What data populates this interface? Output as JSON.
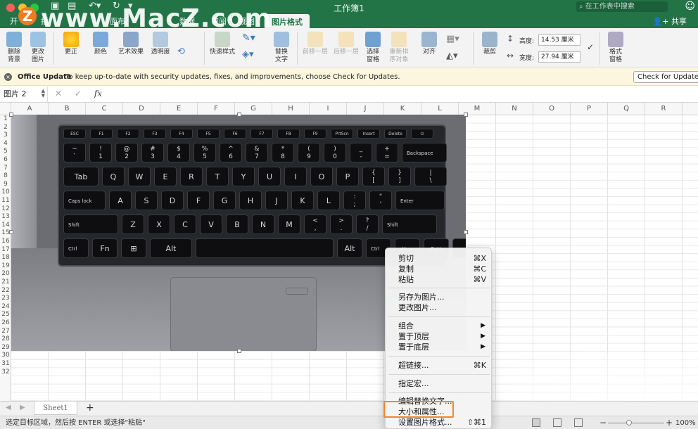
{
  "window": {
    "title": "工作簿1",
    "search_placeholder": "在工作表中搜索",
    "share_label": "共享"
  },
  "watermark": {
    "logo_letter": "Z",
    "text": "www.MacZ.com"
  },
  "tabs": [
    {
      "label": "开"
    },
    {
      "label": "插"
    },
    {
      "label": "面布"
    },
    {
      "label": "数据"
    },
    {
      "label": "审阅"
    },
    {
      "label": "视图"
    },
    {
      "label": "图片格式"
    }
  ],
  "ribbon": {
    "remove_bg": "删除\n背景",
    "change_pic": "更改\n图片",
    "corrections": "更正",
    "color": "颜色",
    "artistic": "艺术效果",
    "transparency": "透明度",
    "quick_styles": "快速样式",
    "alt_text": "替换\n文字",
    "bring_forward": "前移一层",
    "send_backward": "后移一层",
    "selection_pane": "选择\n窗格",
    "reorder": "重新排\n序对象",
    "align": "对齐",
    "crop": "裁剪",
    "height_label": "高度:",
    "height_value": "14.53 厘米",
    "width_label": "宽度:",
    "width_value": "27.94 厘米",
    "format_pane": "格式\n窗格"
  },
  "update_bar": {
    "title": "Office Update",
    "message": "To keep up-to-date with security updates, fixes, and improvements, choose Check for Updates.",
    "button": "Check for Updates"
  },
  "formula_bar": {
    "name_box": "图片 2",
    "fx": "fx"
  },
  "columns": [
    "A",
    "B",
    "C",
    "D",
    "E",
    "F",
    "G",
    "H",
    "I",
    "J",
    "K",
    "L",
    "M",
    "N",
    "O",
    "P",
    "Q",
    "R"
  ],
  "rows": [
    "1",
    "2",
    "3",
    "4",
    "5",
    "6",
    "7",
    "8",
    "9",
    "10",
    "11",
    "12",
    "13",
    "14",
    "15",
    "16",
    "17",
    "18",
    "19",
    "20",
    "21",
    "22",
    "23",
    "24",
    "25",
    "26",
    "27",
    "28",
    "29",
    "30",
    "31",
    "32"
  ],
  "keyboard": {
    "fn_row": [
      "ESC",
      "F1",
      "F2",
      "F3",
      "F4",
      "F5",
      "F6",
      "F7",
      "F8",
      "F9",
      "PrtScn",
      "Insert",
      "Delete",
      "⏻"
    ],
    "row1": [
      "~\n`",
      "!\n1",
      "@\n2",
      "#\n3",
      "$\n4",
      "%\n5",
      "^\n6",
      "&\n7",
      "*\n8",
      "(\n9",
      ")\n0",
      "_\n-",
      "+\n=",
      "Backspace"
    ],
    "row2": [
      "Tab",
      "Q",
      "W",
      "E",
      "R",
      "T",
      "Y",
      "U",
      "I",
      "O",
      "P",
      "{\n[",
      "}\n]",
      "|\n\\"
    ],
    "row3": [
      "Caps lock",
      "A",
      "S",
      "D",
      "F",
      "G",
      "H",
      "J",
      "K",
      "L",
      ":\n;",
      "\"\n'",
      "Enter"
    ],
    "row4": [
      "Shift",
      "Z",
      "X",
      "C",
      "V",
      "B",
      "N",
      "M",
      "<\n,",
      ">\n.",
      "?\n/",
      "Shift"
    ],
    "row5": [
      "Ctrl",
      "Fn",
      "⊞",
      "Alt",
      "",
      "Alt",
      "Ctrl",
      "◂Home",
      "▴PgUp",
      ""
    ]
  },
  "context_menu": {
    "cut": "剪切",
    "cut_sc": "⌘X",
    "copy": "复制",
    "copy_sc": "⌘C",
    "paste": "粘贴",
    "paste_sc": "⌘V",
    "save_as_picture": "另存为图片...",
    "change_picture": "更改图片...",
    "group": "组合",
    "bring_to_front": "置于顶层",
    "send_to_back": "置于底层",
    "hyperlink": "超链接...",
    "hyperlink_sc": "⌘K",
    "assign_macro": "指定宏...",
    "edit_alt_text": "编辑替换文字...",
    "size_properties": "大小和属性...",
    "format_picture": "设置图片格式...",
    "format_picture_sc": "⇧⌘1"
  },
  "sheets": [
    {
      "label": "Sheet1"
    }
  ],
  "status": {
    "message": "选定目标区域，然后按 ENTER 或选择\"粘贴\"",
    "zoom": "100%"
  },
  "colors": {
    "excel_green": "#227447",
    "highlight": "#f0882b"
  }
}
